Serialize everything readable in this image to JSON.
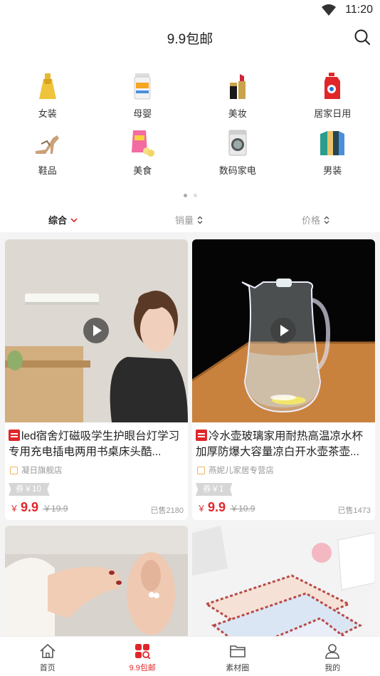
{
  "status_bar": {
    "time": "11:20"
  },
  "header": {
    "title": "9.9包邮"
  },
  "categories": [
    {
      "label": "女装",
      "icon": "dress-icon"
    },
    {
      "label": "母婴",
      "icon": "milk-powder-icon"
    },
    {
      "label": "美妆",
      "icon": "lipstick-icon"
    },
    {
      "label": "居家日用",
      "icon": "detergent-icon"
    },
    {
      "label": "鞋品",
      "icon": "heel-shoe-icon"
    },
    {
      "label": "美食",
      "icon": "snack-icon"
    },
    {
      "label": "数码家电",
      "icon": "washing-machine-icon"
    },
    {
      "label": "男装",
      "icon": "shirts-icon"
    }
  ],
  "carousel": {
    "pages": 2,
    "active_page": 1
  },
  "sort": {
    "comprehensive": "综合",
    "sales": "销量",
    "price": "价格",
    "active": "综合"
  },
  "products": [
    {
      "title": "led宿舍灯磁吸学生护眼台灯学习专用充电插电两用书桌床头酷...",
      "shop": "凝日旗舰店",
      "coupon": "券￥10",
      "currency": "￥",
      "price": "9.9",
      "original_price": "￥19.9",
      "sold": "已售2180",
      "has_video": true
    },
    {
      "title": "冷水壶玻璃家用耐热高温凉水杯加厚防爆大容量凉白开水壶茶壶...",
      "shop": "燕妮儿家居专营店",
      "coupon": "券￥1",
      "currency": "￥",
      "price": "9.9",
      "original_price": "￥10.9",
      "sold": "已售1473",
      "has_video": true
    },
    {
      "has_video": false
    },
    {
      "has_video": false
    }
  ],
  "tabbar": [
    {
      "label": "首页",
      "icon": "home-icon"
    },
    {
      "label": "9.9包邮",
      "icon": "grid-search-icon",
      "active": true
    },
    {
      "label": "素材圈",
      "icon": "folder-icon"
    },
    {
      "label": "我的",
      "icon": "user-icon"
    }
  ],
  "colors": {
    "accent": "#e0262a",
    "muted": "#999999",
    "background": "#f4f4f4"
  }
}
